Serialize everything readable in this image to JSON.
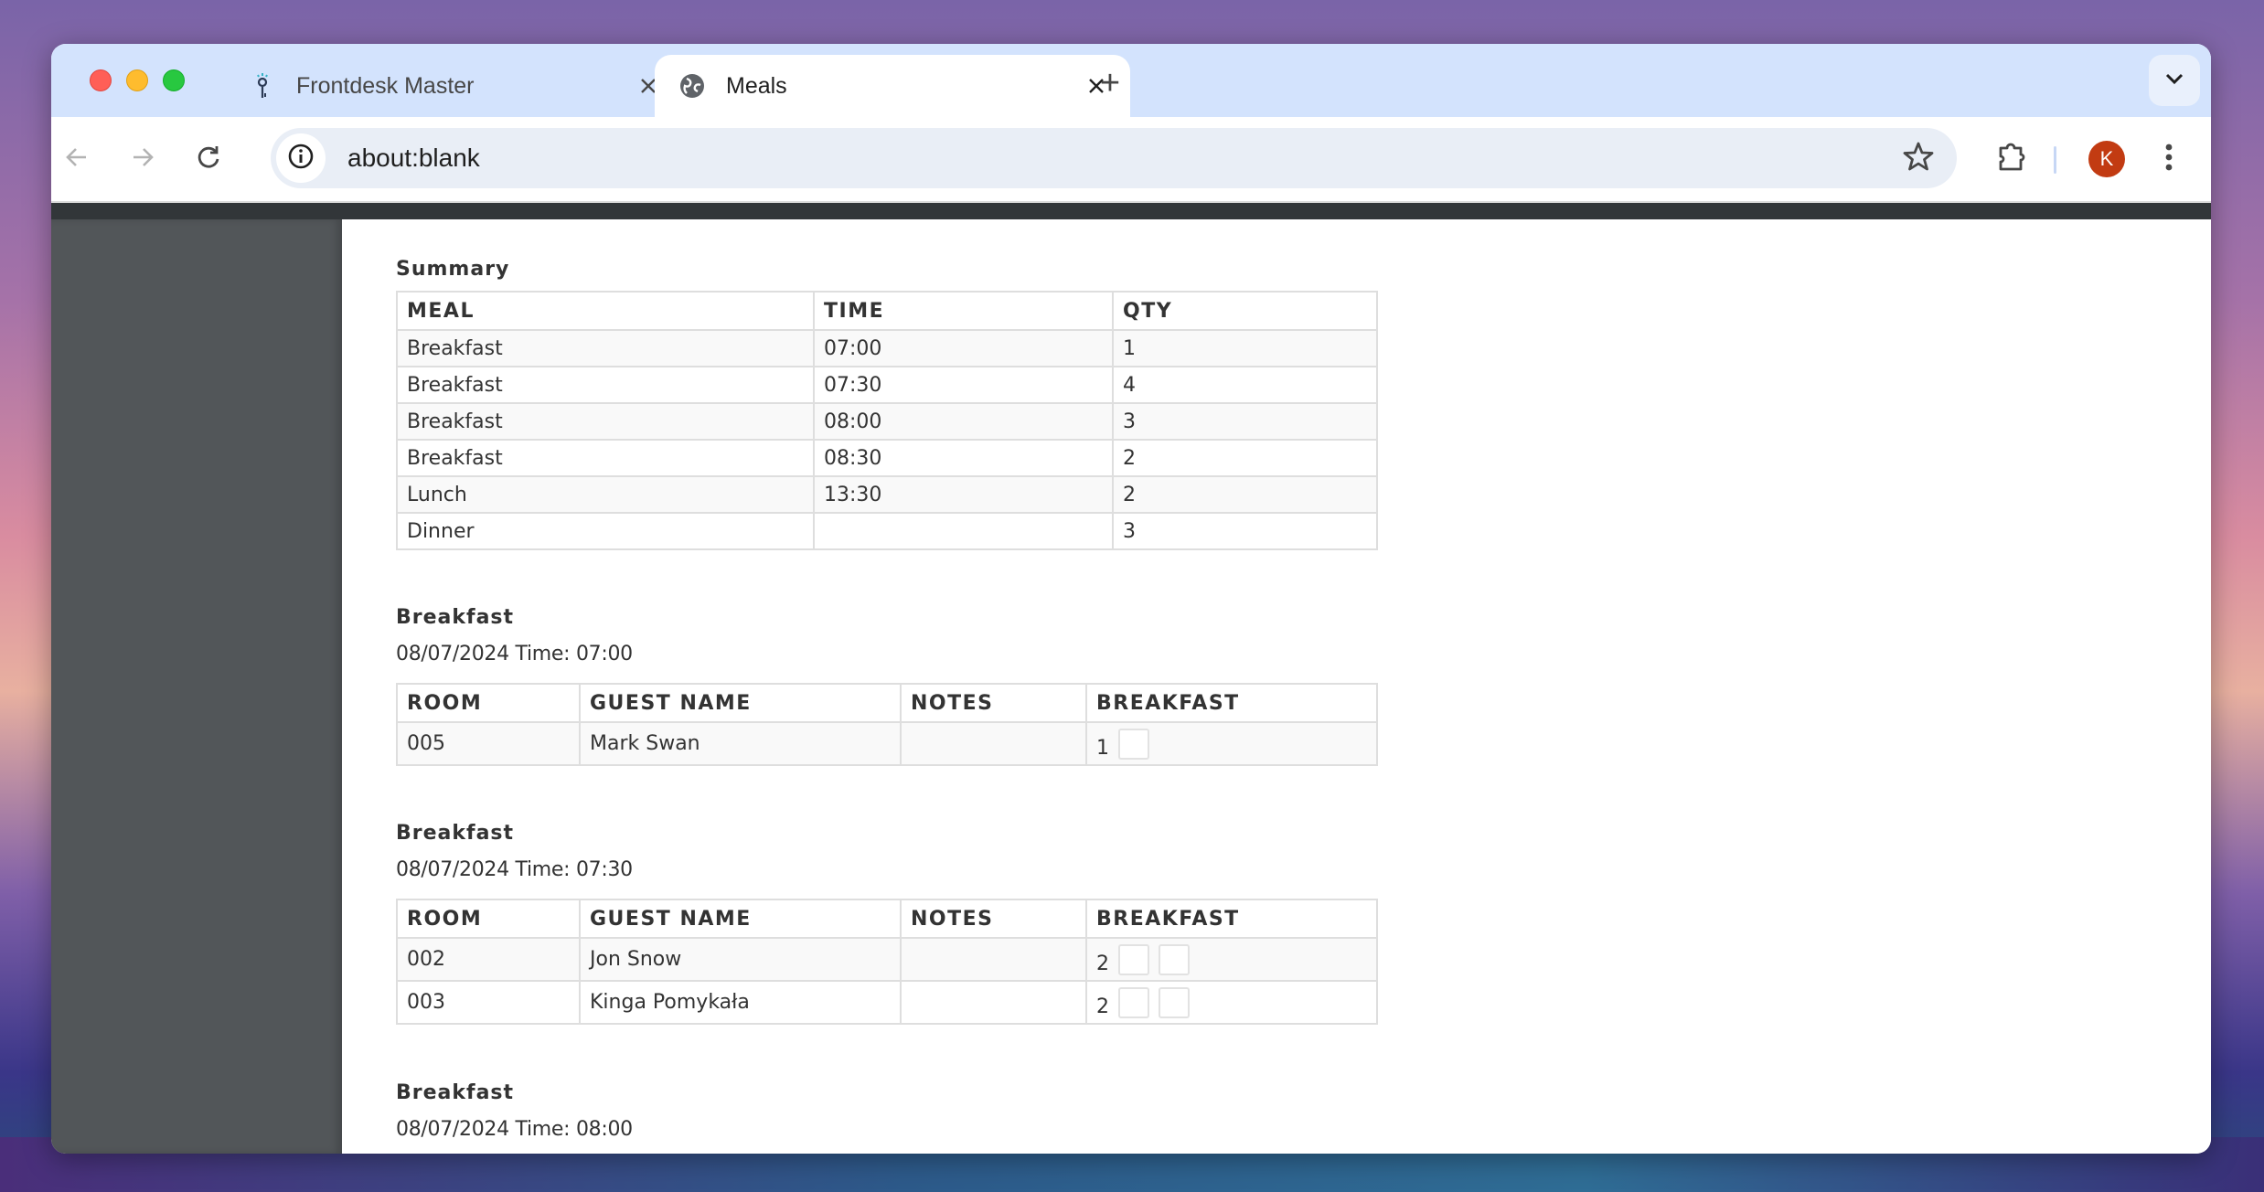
{
  "browser": {
    "tabs": [
      {
        "title": "Frontdesk Master",
        "icon": "frontdesk-key-icon",
        "active": false
      },
      {
        "title": "Meals",
        "icon": "globe-icon",
        "active": true
      }
    ],
    "new_tab_label": "+",
    "url": "about:blank",
    "profile_initial": "K",
    "colors": {
      "tabstrip": "#d3e3fd",
      "avatar": "#c23b12",
      "sidebar": "#525659"
    }
  },
  "summary": {
    "title": "Summary",
    "columns": [
      "MEAL",
      "TIME",
      "QTY"
    ],
    "rows": [
      {
        "meal": "Breakfast",
        "time": "07:00",
        "qty": "1"
      },
      {
        "meal": "Breakfast",
        "time": "07:30",
        "qty": "4"
      },
      {
        "meal": "Breakfast",
        "time": "08:00",
        "qty": "3"
      },
      {
        "meal": "Breakfast",
        "time": "08:30",
        "qty": "2"
      },
      {
        "meal": "Lunch",
        "time": "13:30",
        "qty": "2"
      },
      {
        "meal": "Dinner",
        "time": "",
        "qty": "3"
      }
    ]
  },
  "groups": [
    {
      "title": "Breakfast",
      "subtitle": "08/07/2024 Time: 07:00",
      "columns": [
        "ROOM",
        "GUEST NAME",
        "NOTES",
        "BREAKFAST"
      ],
      "rows": [
        {
          "room": "005",
          "guest": "Mark Swan",
          "notes": "",
          "qty": "1",
          "checkboxes": 1
        }
      ]
    },
    {
      "title": "Breakfast",
      "subtitle": "08/07/2024 Time: 07:30",
      "columns": [
        "ROOM",
        "GUEST NAME",
        "NOTES",
        "BREAKFAST"
      ],
      "rows": [
        {
          "room": "002",
          "guest": "Jon Snow",
          "notes": "",
          "qty": "2",
          "checkboxes": 2
        },
        {
          "room": "003",
          "guest": "Kinga Pomykała",
          "notes": "",
          "qty": "2",
          "checkboxes": 2
        }
      ]
    },
    {
      "title": "Breakfast",
      "subtitle": "08/07/2024 Time: 08:00"
    }
  ]
}
